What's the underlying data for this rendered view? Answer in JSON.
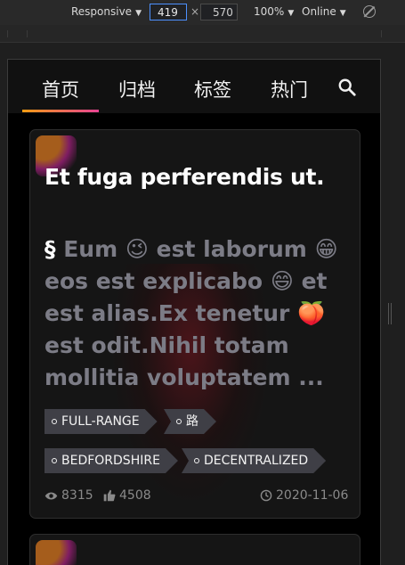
{
  "devtools": {
    "device_mode": "Responsive",
    "width_value": "419",
    "height_value": "570",
    "times_symbol": "×",
    "zoom": "100%",
    "network": "Online",
    "caret": "▼"
  },
  "nav": {
    "tabs": [
      "首页",
      "归档",
      "标签",
      "热门"
    ],
    "active_tab": "首页",
    "accent_gradient": [
      "#f39c12",
      "#e84393"
    ]
  },
  "post": {
    "title": "Et fuga perferendis ut.",
    "section_mark": "§",
    "excerpt_parts": [
      "Eum",
      "😉",
      "est laborum",
      "😁",
      "eos est explicabo",
      "😄",
      "et est alias.Ex tenetur",
      "🍑",
      "est odit.Nihil totam mollitia voluptatem ..."
    ],
    "tags": [
      "FULL-RANGE",
      "路",
      "BEDFORDSHIRE",
      "DECENTRALIZED"
    ],
    "views": "8315",
    "likes": "4508",
    "date": "2020-11-06"
  },
  "colors": {
    "excerpt": "#7c7c86",
    "tag_bg": "#3f3f46",
    "card_bg": "#151515"
  }
}
